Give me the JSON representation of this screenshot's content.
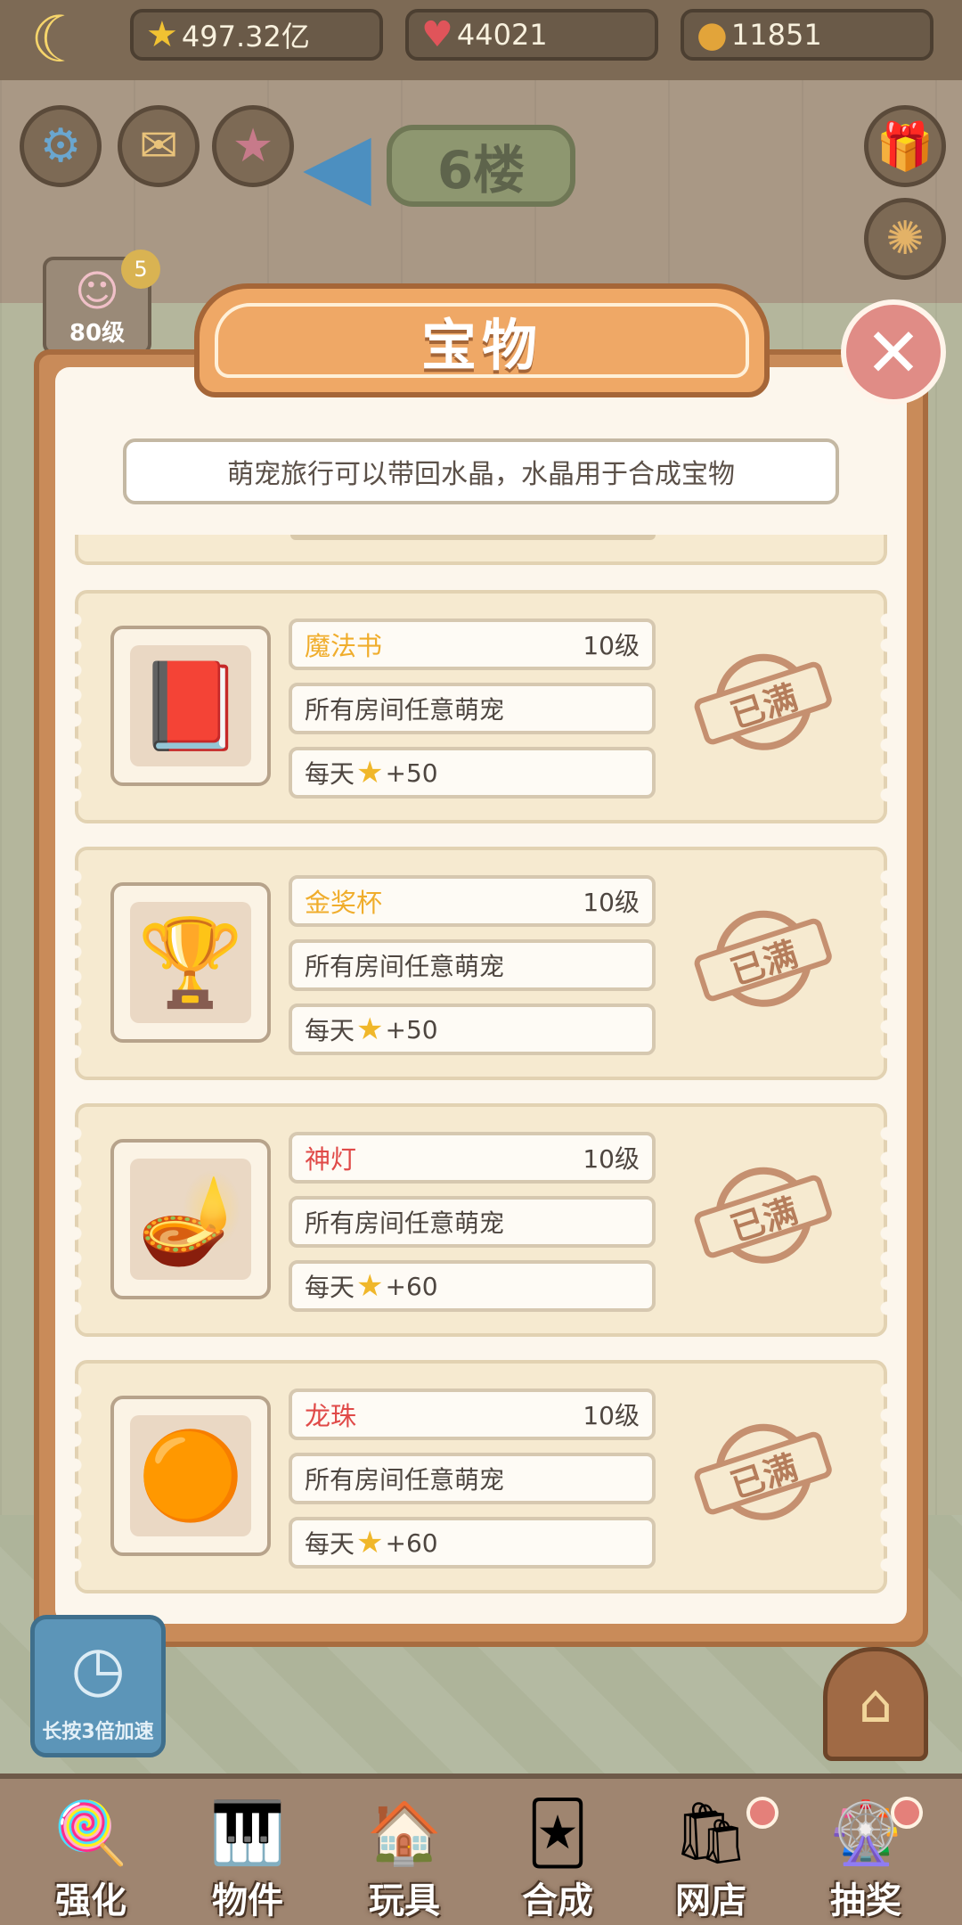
{
  "top_bar": {
    "stars": "497.32亿",
    "hearts": "44021",
    "coins": "11851"
  },
  "floor_sign": "6楼",
  "avatar": {
    "level": "80级",
    "badge": "5"
  },
  "modal": {
    "title": "宝物",
    "hint": "萌宠旅行可以带回水晶，水晶用于合成宝物",
    "items": [
      {
        "name": "魔法书",
        "name_color": "#f0ad2c",
        "level": "10级",
        "desc": "所有房间任意萌宠",
        "rate_prefix": "每天",
        "rate_value": "+50",
        "icon": "magic-book-icon",
        "glyph": "📕",
        "status": "已满"
      },
      {
        "name": "金奖杯",
        "name_color": "#f0ad2c",
        "level": "10级",
        "desc": "所有房间任意萌宠",
        "rate_prefix": "每天",
        "rate_value": "+50",
        "icon": "gold-trophy-icon",
        "glyph": "🏆",
        "status": "已满"
      },
      {
        "name": "神灯",
        "name_color": "#e04a48",
        "level": "10级",
        "desc": "所有房间任意萌宠",
        "rate_prefix": "每天",
        "rate_value": "+60",
        "icon": "magic-lamp-icon",
        "glyph": "🪔",
        "status": "已满"
      },
      {
        "name": "龙珠",
        "name_color": "#e04a48",
        "level": "10级",
        "desc": "所有房间任意萌宠",
        "rate_prefix": "每天",
        "rate_value": "+60",
        "icon": "dragon-ball-icon",
        "glyph": "🟠",
        "status": "已满"
      }
    ]
  },
  "speed_button": "长按3倍加速",
  "nav": [
    {
      "label": "强化",
      "icon": "lollipop-icon",
      "glyph": "🍭"
    },
    {
      "label": "物件",
      "icon": "piano-icon",
      "glyph": "🎹"
    },
    {
      "label": "玩具",
      "icon": "toy-house-icon",
      "glyph": "🏠"
    },
    {
      "label": "合成",
      "icon": "cards-icon",
      "glyph": "🃏"
    },
    {
      "label": "网店",
      "icon": "shop-icon",
      "glyph": "🛍"
    },
    {
      "label": "抽奖",
      "icon": "wheel-icon",
      "glyph": "🎡"
    }
  ]
}
